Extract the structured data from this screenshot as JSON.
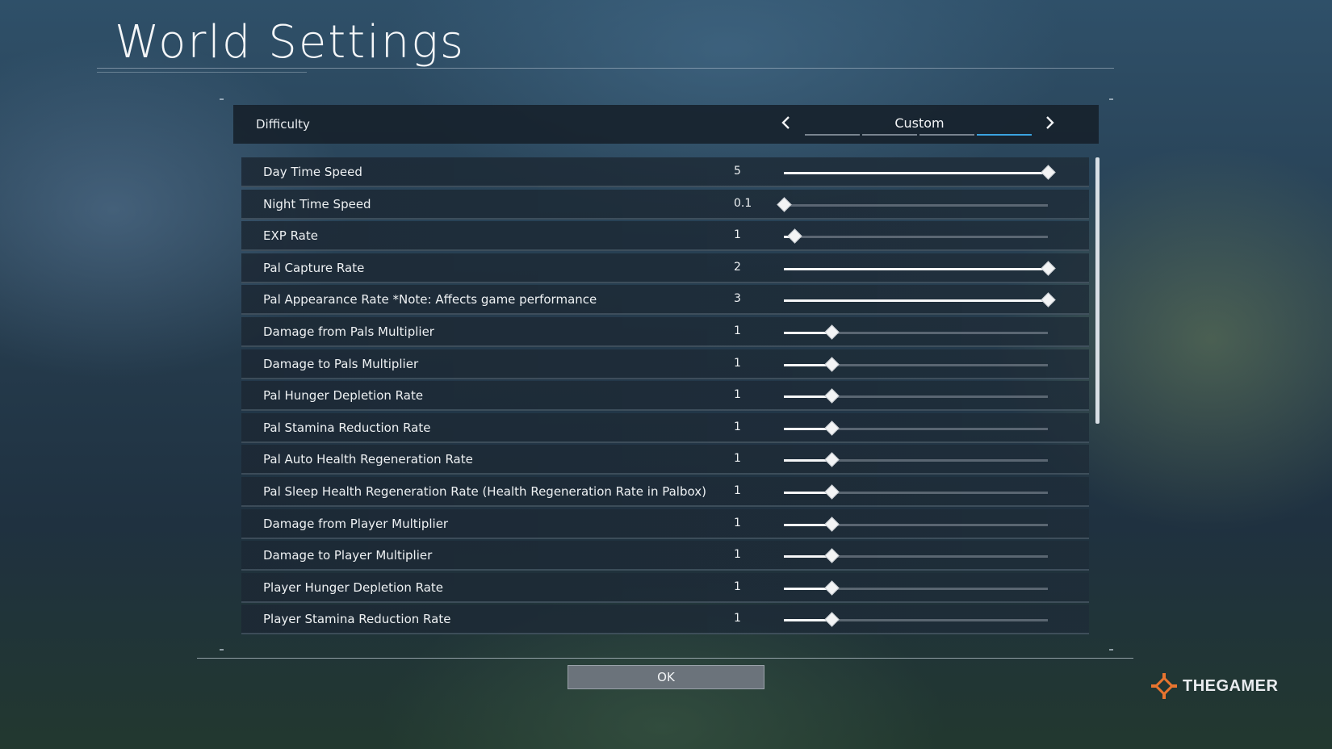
{
  "page": {
    "title": "World Settings"
  },
  "difficulty": {
    "label": "Difficulty",
    "value": "Custom",
    "segment_count": 4,
    "active_segment": 4
  },
  "settings": [
    {
      "label": "Day Time Speed",
      "value": "5",
      "fraction": 1.0
    },
    {
      "label": "Night Time Speed",
      "value": "0.1",
      "fraction": 0.0
    },
    {
      "label": "EXP Rate",
      "value": "1",
      "fraction": 0.04
    },
    {
      "label": "Pal Capture Rate",
      "value": "2",
      "fraction": 1.0
    },
    {
      "label": "Pal Appearance Rate *Note: Affects game performance",
      "value": "3",
      "fraction": 1.0
    },
    {
      "label": "Damage from Pals Multiplier",
      "value": "1",
      "fraction": 0.18
    },
    {
      "label": "Damage to Pals Multiplier",
      "value": "1",
      "fraction": 0.18
    },
    {
      "label": "Pal Hunger Depletion Rate",
      "value": "1",
      "fraction": 0.18
    },
    {
      "label": "Pal Stamina Reduction Rate",
      "value": "1",
      "fraction": 0.18
    },
    {
      "label": "Pal Auto Health Regeneration Rate",
      "value": "1",
      "fraction": 0.18
    },
    {
      "label": "Pal Sleep Health Regeneration Rate (Health Regeneration Rate in Palbox)",
      "value": "1",
      "fraction": 0.18
    },
    {
      "label": "Damage from Player Multiplier",
      "value": "1",
      "fraction": 0.18
    },
    {
      "label": "Damage to Player Multiplier",
      "value": "1",
      "fraction": 0.18
    },
    {
      "label": "Player Hunger Depletion Rate",
      "value": "1",
      "fraction": 0.18
    },
    {
      "label": "Player Stamina Reduction Rate",
      "value": "1",
      "fraction": 0.18
    }
  ],
  "ok_button": {
    "label": "OK"
  },
  "watermark": {
    "text": "THEGAMER"
  }
}
